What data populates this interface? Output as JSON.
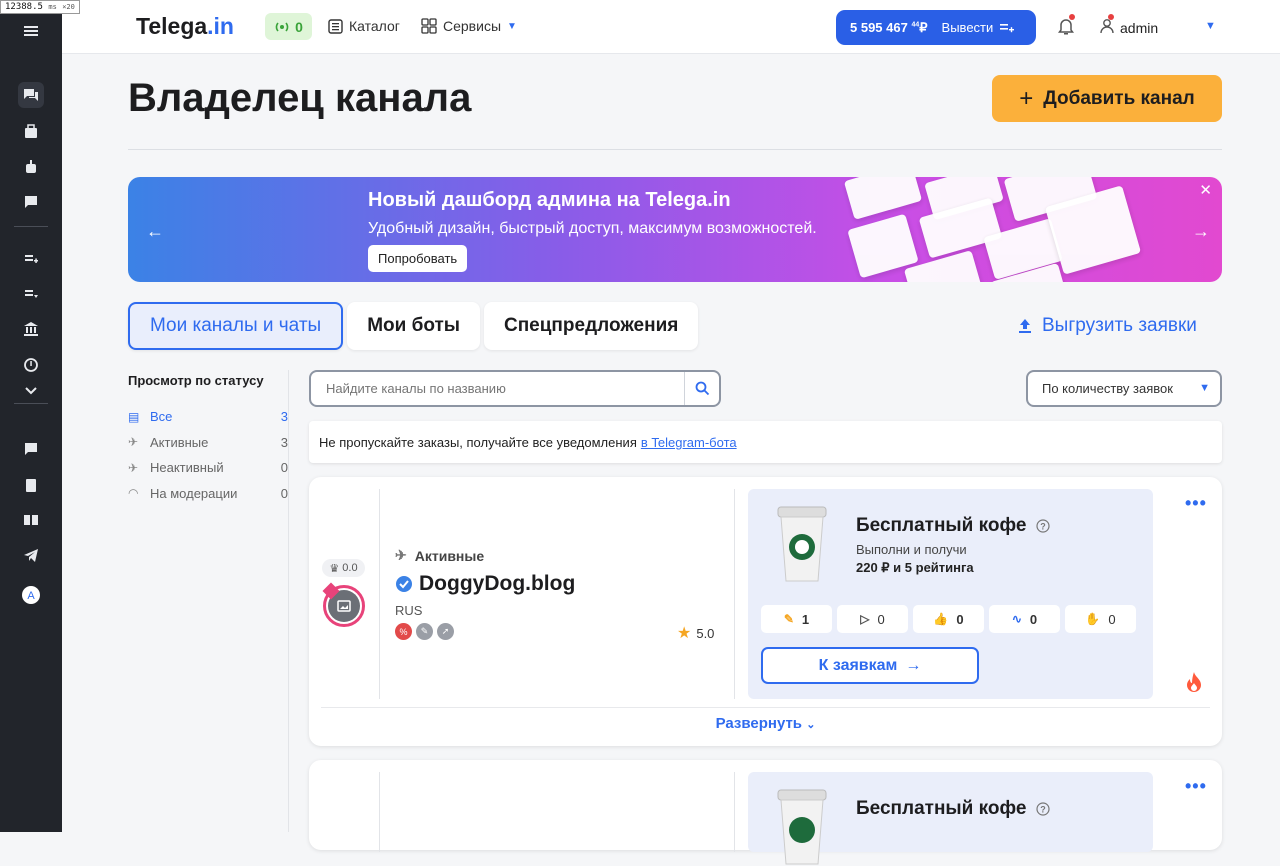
{
  "perf": {
    "value": "12388.5",
    "unit": "ms",
    "mult": "×20"
  },
  "header": {
    "logo_main": "Telega",
    "logo_dot": ".in",
    "wifi_count": "0",
    "catalog": "Каталог",
    "services": "Сервисы",
    "balance_amount": "5 595 467",
    "balance_cents": "44",
    "balance_currency": "₽",
    "withdraw": "Вывести",
    "user": "admin"
  },
  "page": {
    "title": "Владелец канала",
    "add_channel": "Добавить канал"
  },
  "banner": {
    "title": "Новый дашборд админа на Telega.in",
    "subtitle": "Удобный дизайн, быстрый доступ, максимум возможностей.",
    "cta": "Попробовать"
  },
  "tabs": [
    {
      "label": "Мои каналы и чаты",
      "active": true
    },
    {
      "label": "Мои боты",
      "active": false
    },
    {
      "label": "Спецпредложения",
      "active": false
    }
  ],
  "export_label": "Выгрузить заявки",
  "filters": {
    "title": "Просмотр по статусу",
    "items": [
      {
        "label": "Все",
        "count": "3",
        "icon": "inbox-icon"
      },
      {
        "label": "Активные",
        "count": "3",
        "icon": "plane-icon"
      },
      {
        "label": "Неактивный",
        "count": "0",
        "icon": "plane-off-icon"
      },
      {
        "label": "На модерации",
        "count": "0",
        "icon": "wifi-icon"
      }
    ]
  },
  "search": {
    "placeholder": "Найдите каналы по названию"
  },
  "sort": {
    "value": "По количеству заявок"
  },
  "notice": {
    "text": "Не пропускайте заказы, получайте все уведомления",
    "link": "в Telegram-бота"
  },
  "card": {
    "rating_small": "0.0",
    "status": "Активные",
    "name": "DoggyDog.blog",
    "lang": "RUS",
    "stars": "5.0",
    "promo_title": "Бесплатный кофе",
    "promo_sub": "Выполни и получи",
    "promo_reward": "220 ₽ и 5 рейтинга",
    "stats": [
      "1",
      "0",
      "0",
      "0",
      "0"
    ],
    "to_requests": "К заявкам",
    "expand": "Развернуть"
  },
  "card2": {
    "promo_title": "Бесплатный кофе"
  },
  "colors": {
    "accent": "#2f6bef",
    "cta": "#fbb03b",
    "sidebar": "#22252b"
  }
}
